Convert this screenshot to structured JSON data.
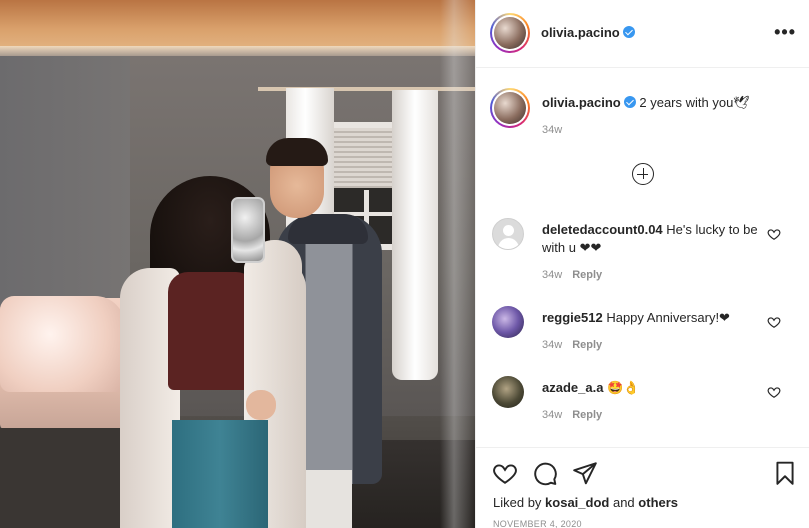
{
  "post": {
    "author": "olivia.pacino",
    "caption_text": "2 years with you🕊",
    "caption_time": "34w",
    "date": "NOVEMBER 4, 2020"
  },
  "header": {
    "username": "olivia.pacino",
    "more_glyph": "•••"
  },
  "comments": [
    {
      "username": "deletedaccount0.04",
      "text": "He's lucky to be with u ❤❤",
      "time": "34w",
      "reply": "Reply"
    },
    {
      "username": "reggie512",
      "text": "Happy Anniversary!❤",
      "time": "34w",
      "reply": "Reply"
    },
    {
      "username": "azade_a.a",
      "text": "🤩👌",
      "time": "34w",
      "reply": "Reply"
    }
  ],
  "likes": {
    "prefix": "Liked by",
    "user": "kosai_dod",
    "joiner": "and",
    "others": "others"
  },
  "icons": {
    "more": "more-options-icon",
    "load_more": "plus-circle-icon",
    "like": "heart-icon",
    "comment": "comment-icon",
    "share": "paper-plane-icon",
    "save": "bookmark-icon"
  },
  "colors": {
    "verified": "#3897f0",
    "text": "#262626",
    "muted": "#8e8e8e",
    "heart_emoji": "#ed2b3c"
  }
}
